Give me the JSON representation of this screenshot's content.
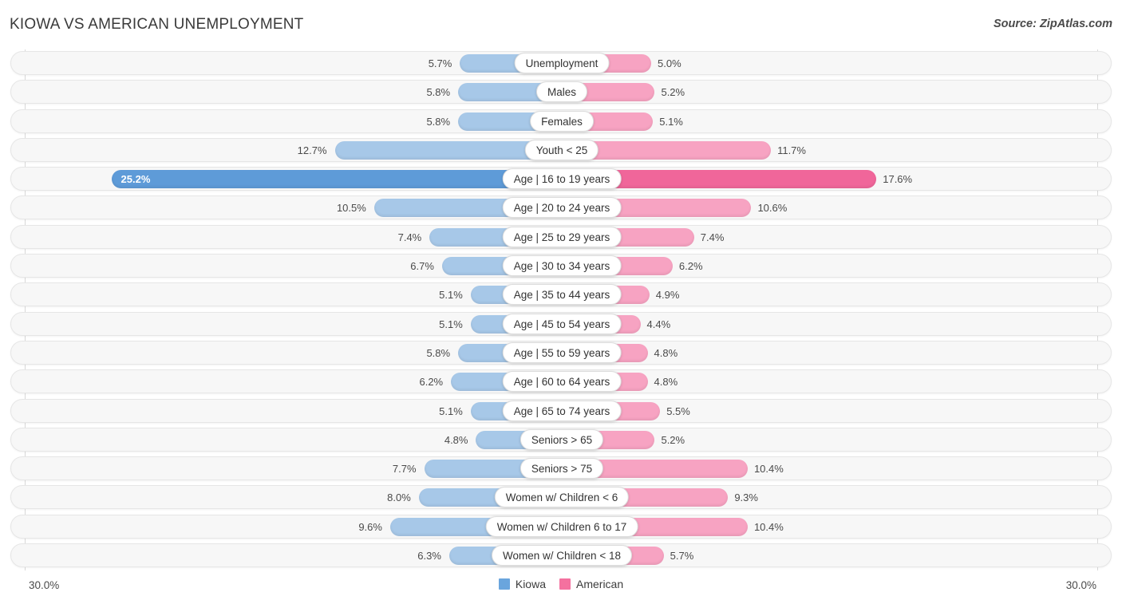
{
  "header": {
    "title": "KIOWA VS AMERICAN UNEMPLOYMENT",
    "source": "Source: ZipAtlas.com"
  },
  "axis": {
    "left_label": "30.0%",
    "right_label": "30.0%",
    "max": 30.0
  },
  "legend": {
    "items": [
      {
        "label": "Kiowa",
        "color": "#6aa5dd"
      },
      {
        "label": "American",
        "color": "#f4719f"
      }
    ]
  },
  "colors": {
    "kiowa_bar": "#a7c8e8",
    "american_bar": "#f7a3c2",
    "kiowa_bar_highlight": "#5e9bd8",
    "american_bar_highlight": "#f0669a",
    "track_bg": "#f7f7f7",
    "track_border": "#e6e6e6",
    "axis_line": "#d8d8d8"
  },
  "chart_data": {
    "type": "bar",
    "orientation": "horizontal-diverging",
    "title": "KIOWA VS AMERICAN UNEMPLOYMENT",
    "xlabel": "",
    "ylabel": "",
    "xlim": [
      -30.0,
      30.0
    ],
    "grid": false,
    "legend_position": "bottom-center",
    "unit": "%",
    "categories": [
      "Unemployment",
      "Males",
      "Females",
      "Youth < 25",
      "Age | 16 to 19 years",
      "Age | 20 to 24 years",
      "Age | 25 to 29 years",
      "Age | 30 to 34 years",
      "Age | 35 to 44 years",
      "Age | 45 to 54 years",
      "Age | 55 to 59 years",
      "Age | 60 to 64 years",
      "Age | 65 to 74 years",
      "Seniors > 65",
      "Seniors > 75",
      "Women w/ Children < 6",
      "Women w/ Children 6 to 17",
      "Women w/ Children < 18"
    ],
    "series": [
      {
        "name": "Kiowa",
        "values": [
          5.7,
          5.8,
          5.8,
          12.7,
          25.2,
          10.5,
          7.4,
          6.7,
          5.1,
          5.1,
          5.8,
          6.2,
          5.1,
          4.8,
          7.7,
          8.0,
          9.6,
          6.3
        ]
      },
      {
        "name": "American",
        "values": [
          5.0,
          5.2,
          5.1,
          11.7,
          17.6,
          10.6,
          7.4,
          6.2,
          4.9,
          4.4,
          4.8,
          4.8,
          5.5,
          5.2,
          10.4,
          9.3,
          10.4,
          5.7
        ]
      }
    ]
  },
  "rows": [
    {
      "label": "Unemployment",
      "left_value": "5.7%",
      "right_value": "5.0%",
      "highlight": false
    },
    {
      "label": "Males",
      "left_value": "5.8%",
      "right_value": "5.2%",
      "highlight": false
    },
    {
      "label": "Females",
      "left_value": "5.8%",
      "right_value": "5.1%",
      "highlight": false
    },
    {
      "label": "Youth < 25",
      "left_value": "12.7%",
      "right_value": "11.7%",
      "highlight": false
    },
    {
      "label": "Age | 16 to 19 years",
      "left_value": "25.2%",
      "right_value": "17.6%",
      "highlight": true
    },
    {
      "label": "Age | 20 to 24 years",
      "left_value": "10.5%",
      "right_value": "10.6%",
      "highlight": false
    },
    {
      "label": "Age | 25 to 29 years",
      "left_value": "7.4%",
      "right_value": "7.4%",
      "highlight": false
    },
    {
      "label": "Age | 30 to 34 years",
      "left_value": "6.7%",
      "right_value": "6.2%",
      "highlight": false
    },
    {
      "label": "Age | 35 to 44 years",
      "left_value": "5.1%",
      "right_value": "4.9%",
      "highlight": false
    },
    {
      "label": "Age | 45 to 54 years",
      "left_value": "5.1%",
      "right_value": "4.4%",
      "highlight": false
    },
    {
      "label": "Age | 55 to 59 years",
      "left_value": "5.8%",
      "right_value": "4.8%",
      "highlight": false
    },
    {
      "label": "Age | 60 to 64 years",
      "left_value": "6.2%",
      "right_value": "4.8%",
      "highlight": false
    },
    {
      "label": "Age | 65 to 74 years",
      "left_value": "5.1%",
      "right_value": "5.5%",
      "highlight": false
    },
    {
      "label": "Seniors > 65",
      "left_value": "4.8%",
      "right_value": "5.2%",
      "highlight": false
    },
    {
      "label": "Seniors > 75",
      "left_value": "7.7%",
      "right_value": "10.4%",
      "highlight": false
    },
    {
      "label": "Women w/ Children < 6",
      "left_value": "8.0%",
      "right_value": "9.3%",
      "highlight": false
    },
    {
      "label": "Women w/ Children 6 to 17",
      "left_value": "9.6%",
      "right_value": "10.4%",
      "highlight": false
    },
    {
      "label": "Women w/ Children < 18",
      "left_value": "6.3%",
      "right_value": "5.7%",
      "highlight": false
    }
  ]
}
